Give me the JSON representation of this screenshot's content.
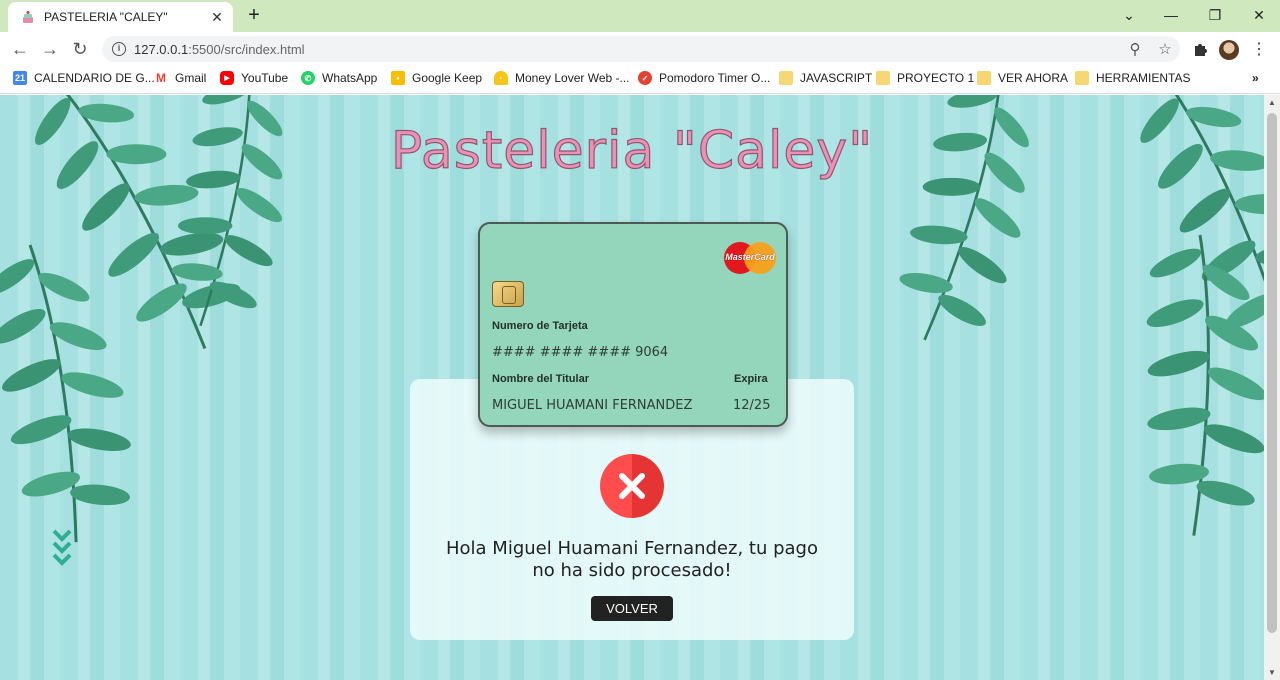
{
  "browser": {
    "tab_title": "PASTELERIA \"CALEY\"",
    "url_host": "127.0.0.1",
    "url_rest": ":5500/src/index.html",
    "bookmarks": [
      {
        "label": "CALENDARIO DE G...",
        "icon": "calendar-icon",
        "color": "#4285f4"
      },
      {
        "label": "Gmail",
        "icon": "gmail-icon",
        "color": "#ea4335"
      },
      {
        "label": "YouTube",
        "icon": "youtube-icon",
        "color": "#ff0000"
      },
      {
        "label": "WhatsApp",
        "icon": "whatsapp-icon",
        "color": "#25d366"
      },
      {
        "label": "Google Keep",
        "icon": "keep-icon",
        "color": "#fbbc04"
      },
      {
        "label": "Money Lover Web -...",
        "icon": "money-lover-icon",
        "color": "#f5c518"
      },
      {
        "label": "Pomodoro Timer O...",
        "icon": "pomodoro-icon",
        "color": "#e44332"
      },
      {
        "label": "JAVASCRIPT",
        "icon": "folder-icon",
        "color": "#f7d774"
      },
      {
        "label": "PROYECTO 1",
        "icon": "folder-icon",
        "color": "#f7d774"
      },
      {
        "label": "VER AHORA",
        "icon": "folder-icon",
        "color": "#f7d774"
      },
      {
        "label": "HERRAMIENTAS",
        "icon": "folder-icon",
        "color": "#f7d774"
      }
    ]
  },
  "site": {
    "title": "Pasteleria \"Caley\""
  },
  "card": {
    "brand": "MasterCard",
    "number_label": "Numero de Tarjeta",
    "number": "#### #### #### 9064",
    "holder_label": "Nombre del Titular",
    "holder": "MIGUEL HUAMANI FERNANDEZ",
    "expiry_label": "Expira",
    "expiry": "12/25"
  },
  "result": {
    "line1": "Hola Miguel Huamani Fernandez, tu pago",
    "line2": "no ha sido procesado!",
    "button": "VOLVER"
  },
  "colors": {
    "title_pink": "#ef8fb3",
    "card_green": "#94d6bc",
    "error_red": "#f23b3b",
    "leaf_green": "#3f9b7a"
  }
}
